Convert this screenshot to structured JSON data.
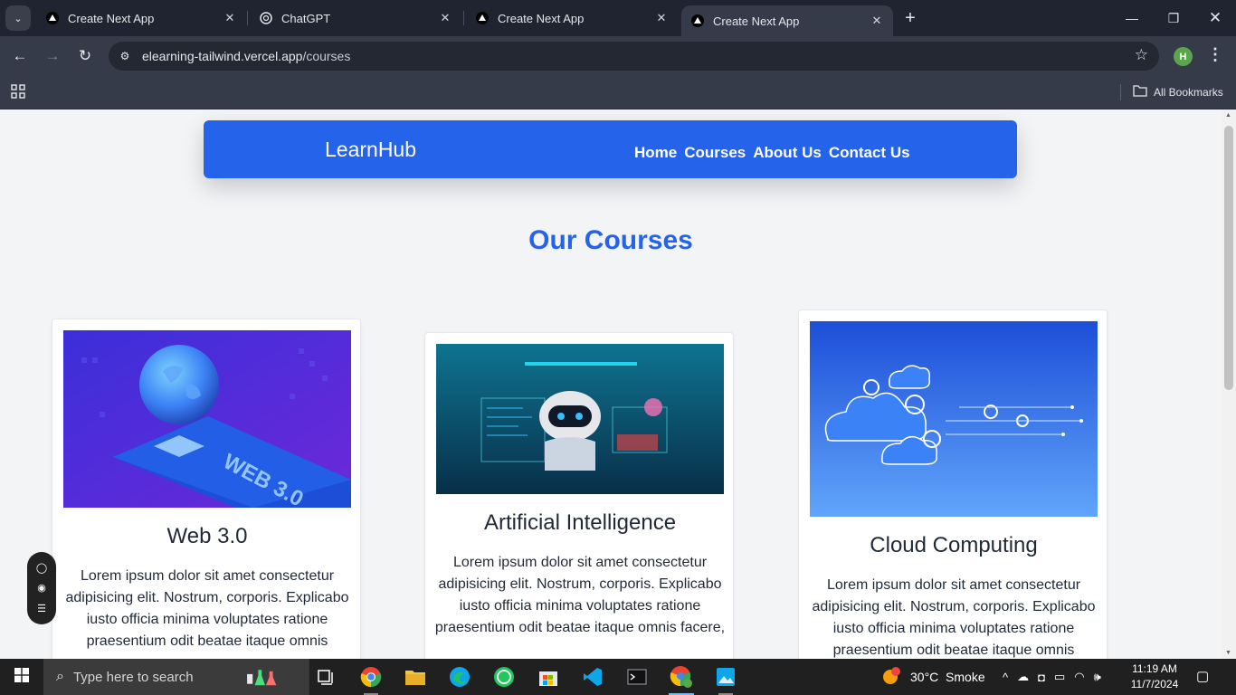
{
  "browser": {
    "tabs": [
      {
        "title": "Create Next App",
        "icon": "nextjs-triangle-icon",
        "active": false
      },
      {
        "title": "ChatGPT",
        "icon": "chatgpt-icon",
        "active": false
      },
      {
        "title": "Create Next App",
        "icon": "nextjs-triangle-icon",
        "active": false
      },
      {
        "title": "Create Next App",
        "icon": "nextjs-triangle-icon",
        "active": true
      }
    ],
    "url_host": "elearning-tailwind.vercel.app",
    "url_path": "/courses",
    "profile_initial": "H",
    "bookmarks_label": "All Bookmarks"
  },
  "site": {
    "logo": "LearnHub",
    "nav": [
      "Home",
      "Courses",
      "About Us",
      "Contact Us"
    ],
    "section_title": "Our Courses",
    "accent_color": "#2563eb",
    "courses": [
      {
        "title": "Web 3.0",
        "image": "web3-globe-illustration",
        "image_text": "WEB 3.0",
        "description": "Lorem ipsum dolor sit amet consectetur adipisicing elit. Nostrum, corporis. Explicabo iusto officia minima voluptates ratione praesentium odit beatae itaque omnis"
      },
      {
        "title": "Artificial Intelligence",
        "image": "ai-robot-illustration",
        "description": "Lorem ipsum dolor sit amet consectetur adipisicing elit. Nostrum, corporis. Explicabo iusto officia minima voluptates ratione praesentium odit beatae itaque omnis facere,"
      },
      {
        "title": "Cloud Computing",
        "image": "cloud-gears-illustration",
        "description": "Lorem ipsum dolor sit amet consectetur adipisicing elit. Nostrum, corporis. Explicabo iusto officia minima voluptates ratione praesentium odit beatae itaque omnis"
      }
    ]
  },
  "taskbar": {
    "search_placeholder": "Type here to search",
    "weather": "30°C  Smoke",
    "time": "11:19 AM",
    "date": "11/7/2024"
  }
}
